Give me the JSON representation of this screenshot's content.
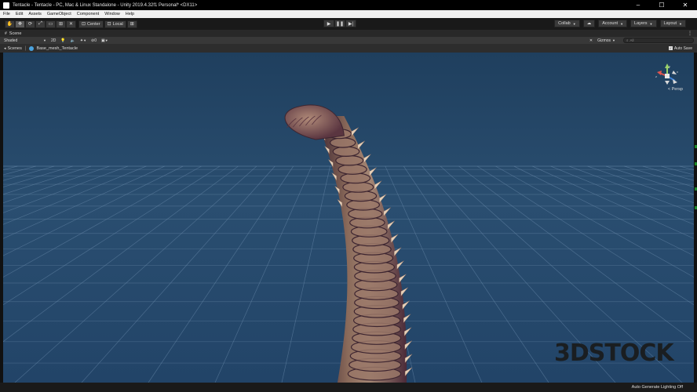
{
  "window": {
    "title": "Tentacle - Tentacle - PC, Mac & Linux Standalone - Unity 2019.4.32f1 Personal* <DX11>",
    "controls": [
      "–",
      "☐",
      "✕"
    ]
  },
  "menu": [
    "File",
    "Edit",
    "Assets",
    "GameObject",
    "Component",
    "Window",
    "Help"
  ],
  "toolbar": {
    "tools": [
      {
        "name": "hand-tool",
        "glyph": "✋"
      },
      {
        "name": "move-tool",
        "glyph": "✥"
      },
      {
        "name": "rotate-tool",
        "glyph": "⟳"
      },
      {
        "name": "scale-tool",
        "glyph": "⤢"
      },
      {
        "name": "rect-tool",
        "glyph": "▭"
      },
      {
        "name": "transform-tool",
        "glyph": "⊞"
      },
      {
        "name": "custom-tool",
        "glyph": "✕"
      }
    ],
    "pivot_center": "Center",
    "pivot_local": "Local",
    "play_buttons": [
      "▶",
      "❚❚",
      "▶|"
    ],
    "collab": "Collab",
    "account": "Account",
    "layers": "Layers",
    "layout": "Layout"
  },
  "scene_tab": {
    "label": "Scene",
    "kebab": "⋮"
  },
  "scene_toolbar": {
    "shading_mode": "Shaded",
    "mode_2d": "2D",
    "hidden_count": "0",
    "gizmos": "Gizmos",
    "search_placeholder": "All"
  },
  "breadcrumb": {
    "root": "Scenes",
    "item": "Base_mesh_Tentacle",
    "autosave": "Auto Save"
  },
  "viewport": {
    "projection": "Persp",
    "watermark": "3DSTOCK",
    "gizmo_axes": [
      "x",
      "y",
      "z"
    ]
  },
  "status": {
    "text": "Auto Generate Lighting Off"
  },
  "colors": {
    "sky": "#2a4e70",
    "grid": "#6a8bab",
    "tentacle_base": "#7a5a4a",
    "tentacle_shadow": "#3d2530",
    "spike": "#e6d0b8"
  }
}
